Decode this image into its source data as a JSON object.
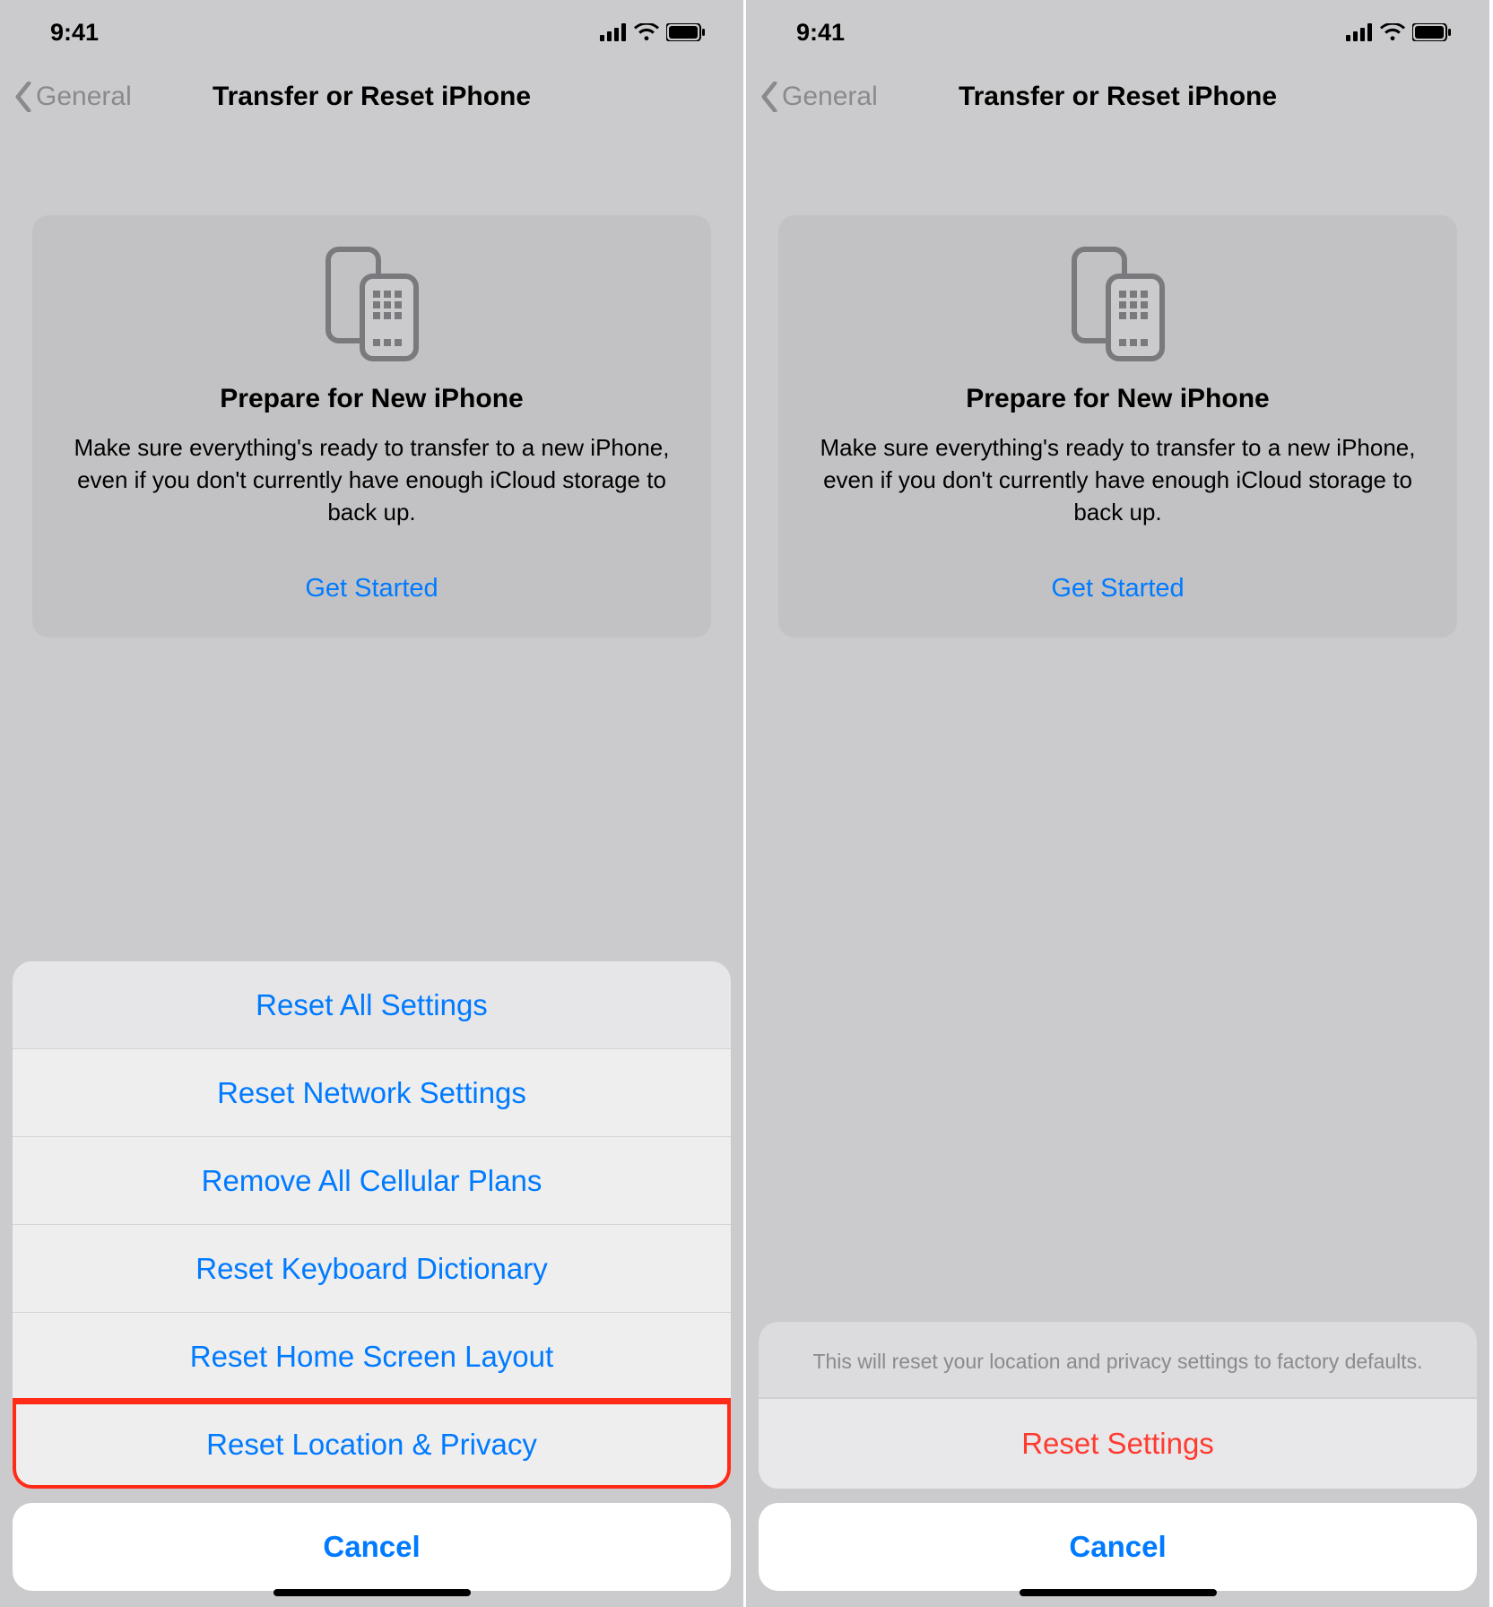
{
  "status": {
    "time": "9:41"
  },
  "nav": {
    "back_label": "General",
    "title": "Transfer or Reset iPhone"
  },
  "card": {
    "title": "Prepare for New iPhone",
    "description": "Make sure everything's ready to transfer to a new iPhone, even if you don't currently have enough iCloud storage to back up.",
    "cta": "Get Started"
  },
  "sheet_left": {
    "items": [
      "Reset All Settings",
      "Reset Network Settings",
      "Remove All Cellular Plans",
      "Reset Keyboard Dictionary",
      "Reset Home Screen Layout",
      "Reset Location & Privacy"
    ],
    "highlight_index": 5,
    "cancel": "Cancel"
  },
  "sheet_right": {
    "message": "This will reset your location and privacy settings to factory defaults.",
    "action": "Reset Settings",
    "cancel": "Cancel"
  }
}
